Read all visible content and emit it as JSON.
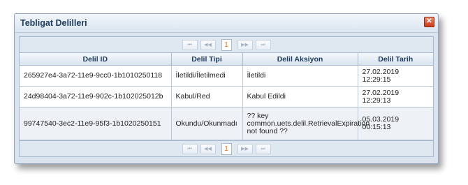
{
  "dialog": {
    "title": "Tebligat Delilleri",
    "close_icon": "close-icon"
  },
  "pager": {
    "first_label": "⏮",
    "prev_label": "◀◀",
    "current_page": "1",
    "next_label": "▶▶",
    "last_label": "⏭"
  },
  "table": {
    "columns": [
      "Delil ID",
      "Delil Tipi",
      "Delil Aksiyon",
      "Delil Tarih"
    ],
    "rows": [
      {
        "id": "265927e4-3a72-11e9-9cc0-1b1010250118",
        "type": "İletildi/İletilmedi",
        "action": "İletildi",
        "date": "27.02.2019",
        "time": "12:29:15"
      },
      {
        "id": "24d98404-3a72-11e9-902c-1b102025012b",
        "type": "Kabul/Red",
        "action": "Kabul Edildi",
        "date": "27.02.2019",
        "time": "12:29:13"
      },
      {
        "id": "99747540-3ec2-11e9-95f3-1b1020250151",
        "type": "Okundu/Okunmadı",
        "action_line1": "?? key",
        "action_line2": "common.uets.delil.RetrievalExpiration",
        "action_line3": "not found ??",
        "date": "05.03.2019",
        "time": "00:15:13"
      }
    ]
  }
}
